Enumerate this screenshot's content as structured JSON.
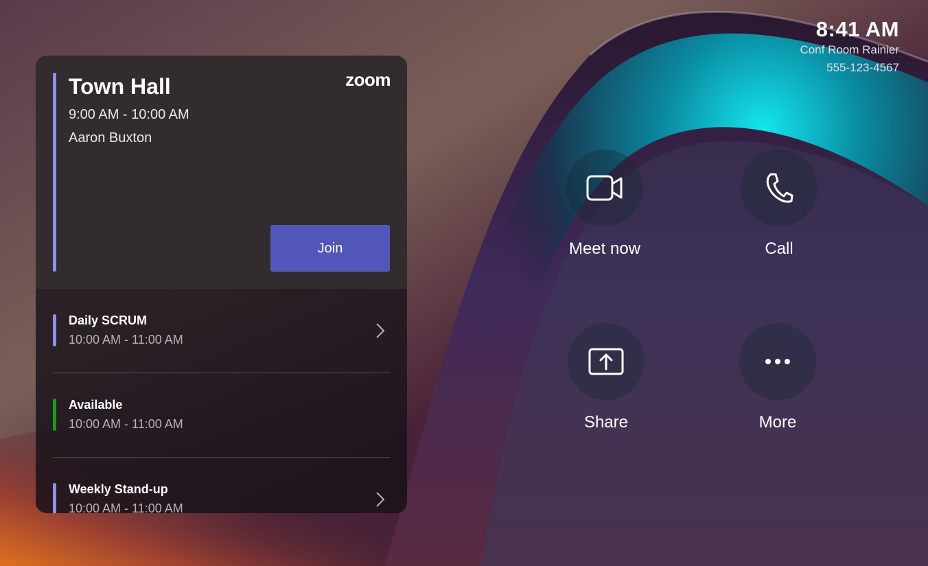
{
  "status": {
    "time": "8:41 AM",
    "room": "Conf Room Rainier",
    "phone": "555-123-4567"
  },
  "current_meeting": {
    "title": "Town Hall",
    "time": "9:00 AM - 10:00 AM",
    "organizer": "Aaron Buxton",
    "provider_logo": "zoom",
    "join_label": "Join",
    "accent_color": "#8f8ff0"
  },
  "agenda": [
    {
      "name": "Daily SCRUM",
      "time": "10:00 AM - 11:00 AM",
      "color": "#8f8ff0",
      "has_chevron": true
    },
    {
      "name": "Available",
      "time": "10:00 AM - 11:00 AM",
      "color": "#13a10e",
      "has_chevron": false
    },
    {
      "name": "Weekly Stand-up",
      "time": "10:00 AM - 11:00 AM",
      "color": "#8f8ff0",
      "has_chevron": true
    }
  ],
  "actions": [
    {
      "label": "Meet now",
      "icon": "video-camera-icon"
    },
    {
      "label": "Call",
      "icon": "phone-icon"
    },
    {
      "label": "Share",
      "icon": "share-screen-icon"
    },
    {
      "label": "More",
      "icon": "more-dots-icon"
    }
  ],
  "colors": {
    "join_button": "#5256b8",
    "accent_teal": "#00c8d8"
  }
}
